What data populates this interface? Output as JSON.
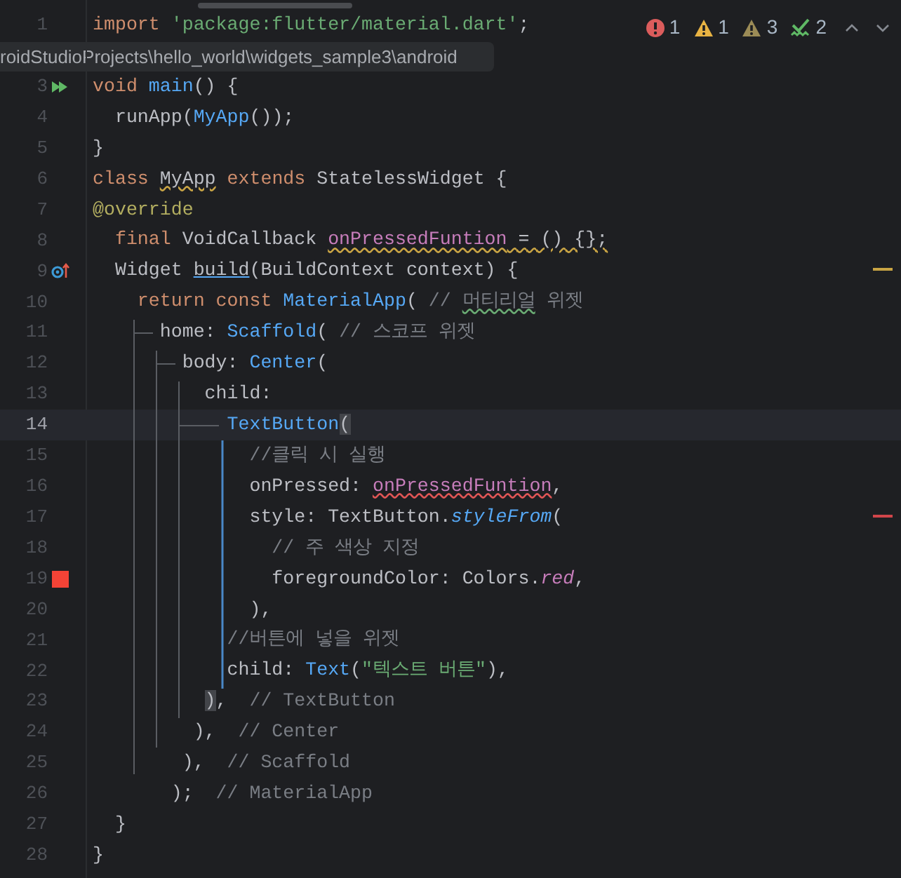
{
  "editor": {
    "lines": [
      {
        "number": "1",
        "tokens": [
          {
            "text": "import ",
            "kind": "keyword"
          },
          {
            "text": "'package:flutter/material.dart'",
            "kind": "string"
          },
          {
            "text": ";",
            "kind": "plain"
          }
        ]
      },
      {
        "number": "3",
        "gutter": {
          "kind": "run"
        },
        "tokens": [
          {
            "text": "void ",
            "kind": "keyword"
          },
          {
            "text": "main",
            "kind": "function"
          },
          {
            "text": "() {",
            "kind": "plain"
          }
        ]
      },
      {
        "number": "4",
        "tokens": [
          {
            "text": "  runApp(",
            "kind": "plain"
          },
          {
            "text": "MyApp",
            "kind": "function"
          },
          {
            "text": "());",
            "kind": "plain"
          }
        ]
      },
      {
        "number": "5",
        "tokens": [
          {
            "text": "}",
            "kind": "plain"
          }
        ]
      },
      {
        "number": "6",
        "tokens": [
          {
            "text": "class ",
            "kind": "keyword"
          },
          {
            "text": "MyApp",
            "kind": "plain",
            "underline": {
              "kind": "warning"
            }
          },
          {
            "text": " extends ",
            "kind": "keyword"
          },
          {
            "text": "StatelessWidget {",
            "kind": "plain"
          }
        ]
      },
      {
        "number": "7",
        "tokens": [
          {
            "text": "@override",
            "kind": "annotation"
          }
        ]
      },
      {
        "number": "8",
        "tokens": [
          {
            "text": "  final ",
            "kind": "keyword"
          },
          {
            "text": "VoidCallback ",
            "kind": "plain"
          },
          {
            "text": "onPressedFuntion",
            "kind": "field",
            "underline": {
              "kind": "warning"
            }
          },
          {
            "text": " = () {};",
            "kind": "plain",
            "underline": {
              "kind": "warning"
            }
          }
        ]
      },
      {
        "number": "9",
        "gutter": {
          "kind": "override"
        },
        "stripe": {
          "kind": "warning"
        },
        "tokens": [
          {
            "text": "  Widget ",
            "kind": "plain"
          },
          {
            "text": "build",
            "kind": "plain",
            "underline": {
              "kind": "usage"
            }
          },
          {
            "text": "(BuildContext context) {",
            "kind": "plain"
          }
        ]
      },
      {
        "number": "10",
        "tokens": [
          {
            "text": "    return const ",
            "kind": "keyword"
          },
          {
            "text": "MaterialApp",
            "kind": "function"
          },
          {
            "text": "( ",
            "kind": "plain"
          },
          {
            "text": "// ",
            "kind": "comment"
          },
          {
            "text": "머티리얼",
            "kind": "comment",
            "underline": {
              "kind": "typo"
            }
          },
          {
            "text": " 위젯",
            "kind": "comment"
          }
        ]
      },
      {
        "number": "11",
        "tokens": [
          {
            "text": "      home: ",
            "kind": "plain"
          },
          {
            "text": "Scaffold",
            "kind": "function"
          },
          {
            "text": "( ",
            "kind": "plain"
          },
          {
            "text": "// 스코프 위젯",
            "kind": "comment"
          }
        ]
      },
      {
        "number": "12",
        "tokens": [
          {
            "text": "        body: ",
            "kind": "plain"
          },
          {
            "text": "Center",
            "kind": "function"
          },
          {
            "text": "(",
            "kind": "plain"
          }
        ]
      },
      {
        "number": "13",
        "tokens": [
          {
            "text": "          child:",
            "kind": "plain"
          }
        ]
      },
      {
        "number": "14",
        "current": true,
        "tokens": [
          {
            "text": "            TextButton",
            "kind": "function"
          },
          {
            "text": "(",
            "kind": "plain",
            "match": true
          }
        ]
      },
      {
        "number": "15",
        "tokens": [
          {
            "text": "              //클릭 시 실행",
            "kind": "comment"
          }
        ]
      },
      {
        "number": "16",
        "tokens": [
          {
            "text": "              onPressed: ",
            "kind": "plain"
          },
          {
            "text": "onPressedFuntion",
            "kind": "field",
            "underline": {
              "kind": "error"
            }
          },
          {
            "text": ",",
            "kind": "plain"
          }
        ]
      },
      {
        "number": "17",
        "stripe": {
          "kind": "error"
        },
        "tokens": [
          {
            "text": "              style: TextButton.",
            "kind": "plain"
          },
          {
            "text": "styleFrom",
            "kind": "static_function"
          },
          {
            "text": "(",
            "kind": "plain"
          }
        ]
      },
      {
        "number": "18",
        "tokens": [
          {
            "text": "                // 주 색상 지정",
            "kind": "comment"
          }
        ]
      },
      {
        "number": "19",
        "gutter": {
          "kind": "color_swatch",
          "color": "#f44336"
        },
        "tokens": [
          {
            "text": "                foregroundColor: Colors.",
            "kind": "plain"
          },
          {
            "text": "red",
            "kind": "static_field"
          },
          {
            "text": ",",
            "kind": "plain"
          }
        ]
      },
      {
        "number": "20",
        "tokens": [
          {
            "text": "              ),",
            "kind": "plain"
          }
        ]
      },
      {
        "number": "21",
        "tokens": [
          {
            "text": "            //버튼에 넣을 위젯",
            "kind": "comment"
          }
        ]
      },
      {
        "number": "22",
        "tokens": [
          {
            "text": "            child: ",
            "kind": "plain"
          },
          {
            "text": "Text",
            "kind": "function"
          },
          {
            "text": "(",
            "kind": "plain"
          },
          {
            "text": "\"텍스트 버튼\"",
            "kind": "string"
          },
          {
            "text": "),",
            "kind": "plain"
          }
        ]
      },
      {
        "number": "23",
        "tokens": [
          {
            "text": "          )",
            "kind": "plain",
            "match": true
          },
          {
            "text": ",  ",
            "kind": "plain"
          },
          {
            "text": "// TextButton",
            "kind": "comment"
          }
        ]
      },
      {
        "number": "24",
        "tokens": [
          {
            "text": "         ),  ",
            "kind": "plain"
          },
          {
            "text": "// Center",
            "kind": "comment"
          }
        ]
      },
      {
        "number": "25",
        "tokens": [
          {
            "text": "        ),  ",
            "kind": "plain"
          },
          {
            "text": "// Scaffold",
            "kind": "comment"
          }
        ]
      },
      {
        "number": "26",
        "tokens": [
          {
            "text": "       );  ",
            "kind": "plain"
          },
          {
            "text": "// MaterialApp",
            "kind": "comment"
          }
        ]
      },
      {
        "number": "27",
        "tokens": [
          {
            "text": "  }",
            "kind": "plain"
          }
        ]
      },
      {
        "number": "28",
        "tokens": [
          {
            "text": "}",
            "kind": "plain"
          }
        ]
      }
    ]
  },
  "inspections": [
    {
      "kind": "error",
      "count": "1"
    },
    {
      "kind": "warning",
      "count": "1"
    },
    {
      "kind": "weak_warning",
      "count": "3"
    },
    {
      "kind": "typo",
      "count": "2"
    }
  ],
  "tooltip": {
    "text": "roidStudioProjects\\hello_world\\widgets_sample3\\android"
  }
}
